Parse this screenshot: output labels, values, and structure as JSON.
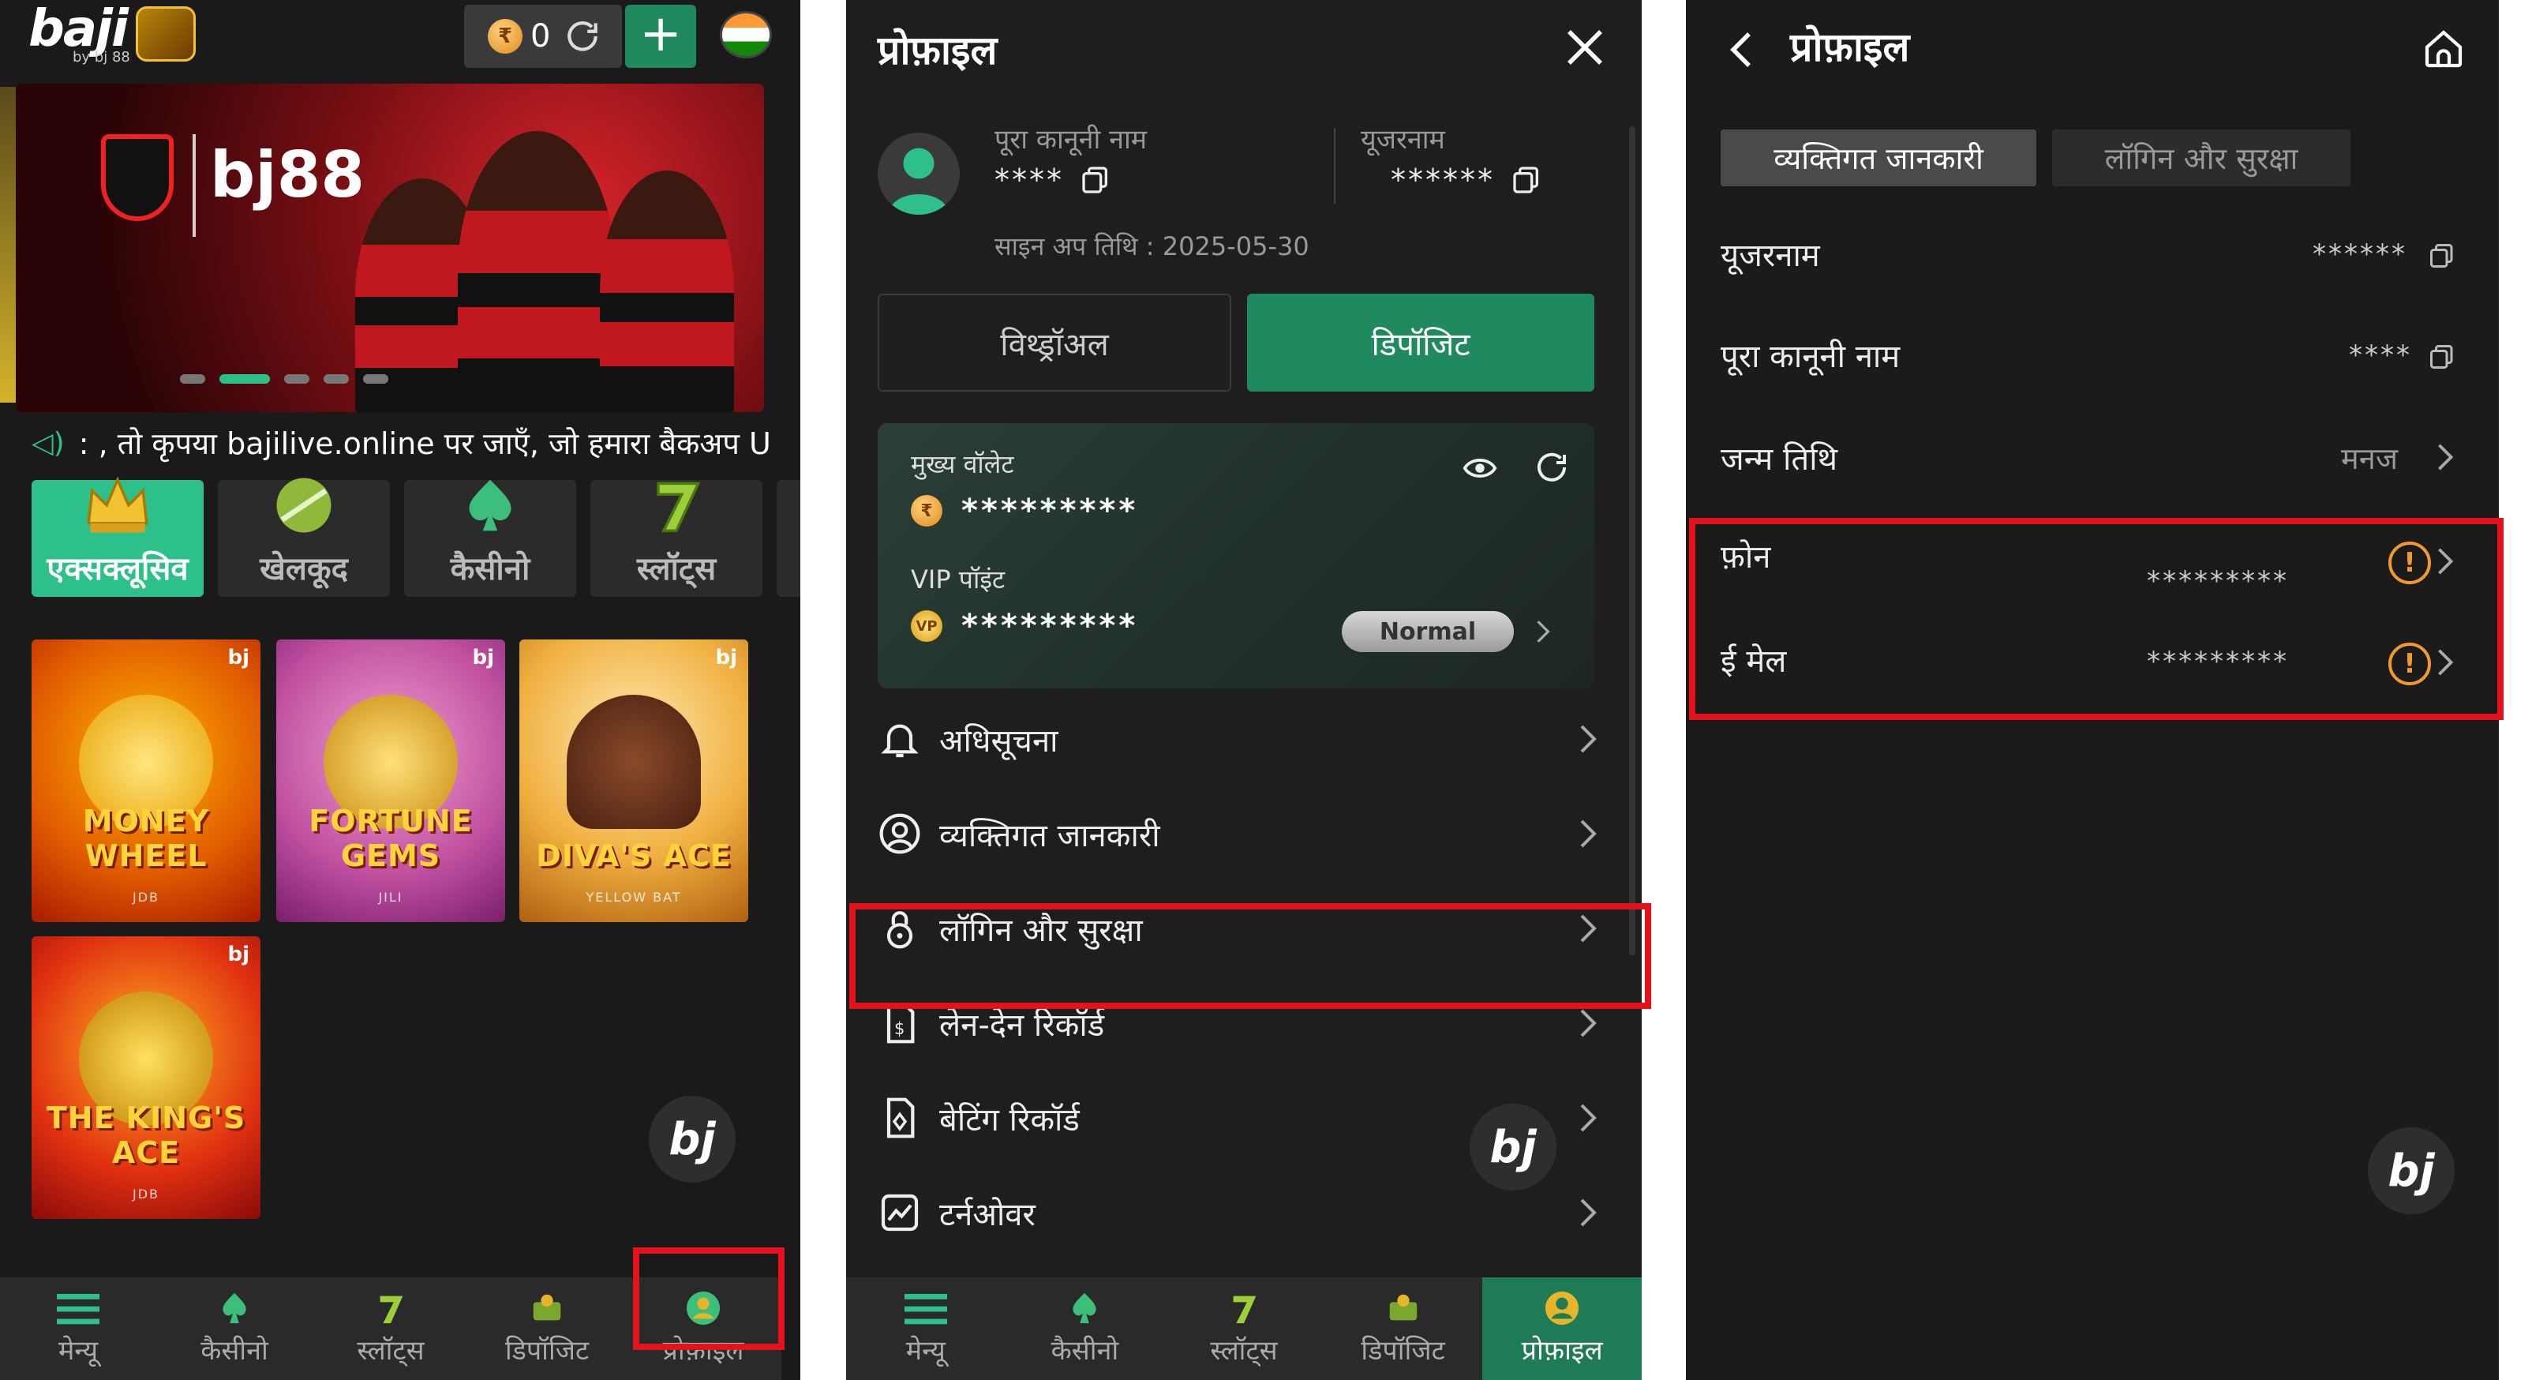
{
  "panel1": {
    "logo": "baji",
    "logo_sub": "by bj 88",
    "balance": "0",
    "currency_symbol": "₹",
    "add_label": "+",
    "banner": {
      "brand": "bj88"
    },
    "ticker": ": , तो कृपया bajilive.online पर जाएँ, जो हमारा बैकअप U",
    "categories": [
      "एक्सक्लूसिव",
      "खेलकूद",
      "कैसीनो",
      "स्लॉट्स"
    ],
    "games": [
      {
        "title": "MONEY WHEEL",
        "provider": "JDB",
        "bj": "bj"
      },
      {
        "title": "FORTUNE GEMS",
        "provider": "JILI",
        "bj": "bj"
      },
      {
        "title": "DIVA'S ACE",
        "provider": "YELLOW BAT",
        "bj": "bj"
      },
      {
        "title": "THE KING'S ACE",
        "provider": "JDB",
        "bj": "bj"
      }
    ],
    "fab": "bj",
    "nav": [
      "मेन्यू",
      "कैसीनो",
      "स्लॉट्स",
      "डिपॉजिट",
      "प्रोफ़ाइल"
    ]
  },
  "panel2": {
    "title": "प्रोफ़ाइल",
    "full_name_label": "पूरा कानूनी नाम",
    "full_name_value": "****",
    "username_label": "यूजरनाम",
    "username_value": "******",
    "signup": "साइन अप तिथि : 2025-05-30",
    "withdraw": "विथ्ड्रॉअल",
    "deposit": "डिपॉजिट",
    "wallet_label": "मुख्य वॉलेट",
    "wallet_value": "*********",
    "vip_label": "VIP पॉइंट",
    "vip_value": "*********",
    "vip_level": "Normal",
    "menu": [
      "अधिसूचना",
      "व्यक्तिगत जानकारी",
      "लॉगिन और सुरक्षा",
      "लेन-देन रिकॉर्ड",
      "बेटिंग रिकॉर्ड",
      "टर्नओवर"
    ],
    "fab": "bj",
    "nav": [
      "मेन्यू",
      "कैसीनो",
      "स्लॉट्स",
      "डिपॉजिट",
      "प्रोफ़ाइल"
    ]
  },
  "panel3": {
    "title": "प्रोफ़ाइल",
    "tabs": [
      "व्यक्तिगत जानकारी",
      "लॉगिन और सुरक्षा"
    ],
    "rows": [
      {
        "label": "यूजरनाम",
        "value": "******"
      },
      {
        "label": "पूरा कानूनी नाम",
        "value": "****"
      },
      {
        "label": "जन्म तिथि",
        "value": "मनज"
      },
      {
        "label": "फ़ोन",
        "value": "*********"
      },
      {
        "label": "ई मेल",
        "value": "*********"
      }
    ],
    "warn_symbol": "!",
    "fab": "bj"
  },
  "colors": {
    "accent_green": "#1f8a5e",
    "highlight_red": "#e3121b",
    "warning_orange": "#f39a2e"
  },
  "icons": [
    "coin-icon",
    "refresh-icon",
    "plus-icon",
    "india-flag-icon",
    "speaker-icon",
    "copy-icon",
    "close-icon",
    "eye-icon",
    "bell-icon",
    "user-circle-icon",
    "lock-icon",
    "document-icon",
    "bet-slip-icon",
    "chart-icon",
    "chevron-right-icon",
    "back-icon",
    "home-icon",
    "warning-icon",
    "menu-icon",
    "casino-icon",
    "slots-icon",
    "deposit-icon",
    "profile-icon"
  ]
}
